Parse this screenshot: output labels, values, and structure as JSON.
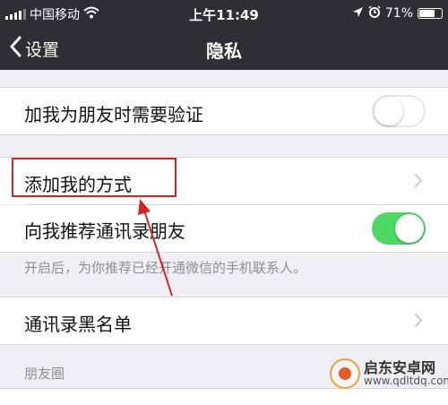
{
  "status_bar": {
    "carrier": "中国移动",
    "time": "上午11:49",
    "battery_percent": "71%",
    "battery_level": 0.71
  },
  "nav": {
    "back_label": "设置",
    "title": "隐私"
  },
  "settings": {
    "verify_label": "加我为朋友时需要验证",
    "verify_on": false,
    "add_methods_label": "添加我的方式",
    "recommend_label": "向我推荐通讯录朋友",
    "recommend_on": true,
    "recommend_hint": "开启后，为你推荐已经开通微信的手机联系人。",
    "blacklist_label": "通讯录黑名单",
    "moments_header": "朋友圈"
  },
  "watermark": {
    "name": "启东安卓网",
    "site": "www.qdltdq.com"
  },
  "colors": {
    "bar": "#2e2e33",
    "toggle_on": "#4cd964",
    "highlight": "#d0242b"
  },
  "icons": [
    "wifi-icon",
    "chevron-left-icon",
    "location-icon",
    "alarm-icon",
    "battery-icon",
    "chevron-right-icon"
  ]
}
